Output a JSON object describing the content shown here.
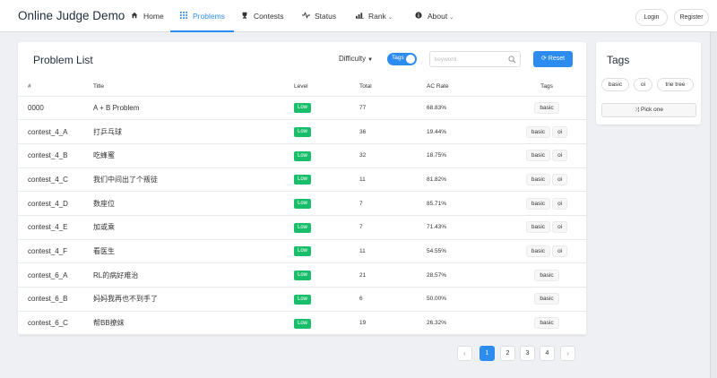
{
  "navbar": {
    "brand": "Online Judge Demo",
    "items": [
      {
        "label": "Home",
        "icon": "home-icon"
      },
      {
        "label": "Problems",
        "icon": "grid-icon",
        "active": true
      },
      {
        "label": "Contests",
        "icon": "trophy-icon"
      },
      {
        "label": "Status",
        "icon": "pulse-icon"
      },
      {
        "label": "Rank",
        "icon": "bar-chart-icon"
      },
      {
        "label": "About",
        "icon": "info-icon"
      }
    ],
    "login_label": "Login",
    "register_label": "Register"
  },
  "problem_panel": {
    "title": "Problem List",
    "difficulty_label": "Difficulty",
    "tags_toggle_label": "Tags",
    "tags_toggle_on": true,
    "search_placeholder": "keyword",
    "reset_label": "Reset",
    "columns": [
      "#",
      "Title",
      "Level",
      "Total",
      "AC Rate",
      "Tags"
    ],
    "rows": [
      {
        "id": "0000",
        "title": "A + B Problem",
        "level": "Low",
        "total": "77",
        "ac_rate": "68.83%",
        "tags": [
          "basic"
        ]
      },
      {
        "id": "contest_4_A",
        "title": "打乒乓球",
        "level": "Low",
        "total": "36",
        "ac_rate": "19.44%",
        "tags": [
          "basic",
          "oi"
        ]
      },
      {
        "id": "contest_4_B",
        "title": "吃蜂蜜",
        "level": "Low",
        "total": "32",
        "ac_rate": "18.75%",
        "tags": [
          "basic",
          "oi"
        ]
      },
      {
        "id": "contest_4_C",
        "title": "我们中间出了个叛徒",
        "level": "Low",
        "total": "11",
        "ac_rate": "81.82%",
        "tags": [
          "basic",
          "oi"
        ]
      },
      {
        "id": "contest_4_D",
        "title": "数座位",
        "level": "Low",
        "total": "7",
        "ac_rate": "85.71%",
        "tags": [
          "basic",
          "oi"
        ]
      },
      {
        "id": "contest_4_E",
        "title": "加或乘",
        "level": "Low",
        "total": "7",
        "ac_rate": "71.43%",
        "tags": [
          "basic",
          "oi"
        ]
      },
      {
        "id": "contest_4_F",
        "title": "看医生",
        "level": "Low",
        "total": "11",
        "ac_rate": "54.55%",
        "tags": [
          "basic",
          "oi"
        ]
      },
      {
        "id": "contest_6_A",
        "title": "RL的病好难治",
        "level": "Low",
        "total": "21",
        "ac_rate": "28.57%",
        "tags": [
          "basic"
        ]
      },
      {
        "id": "contest_6_B",
        "title": "妈妈我再也不到手了",
        "level": "Low",
        "total": "6",
        "ac_rate": "50.00%",
        "tags": [
          "basic"
        ]
      },
      {
        "id": "contest_6_C",
        "title": "帮BB撩妹",
        "level": "Low",
        "total": "19",
        "ac_rate": "26.32%",
        "tags": [
          "basic"
        ]
      }
    ]
  },
  "pagination": {
    "pages": [
      "1",
      "2",
      "3",
      "4"
    ],
    "current": "1",
    "prev_symbol": "‹",
    "next_symbol": "›"
  },
  "tags_panel": {
    "title": "Tags",
    "tags": [
      "basic",
      "oi",
      "trie tree"
    ],
    "pick_label": "Pick one"
  },
  "colors": {
    "accent": "#2d8cf0",
    "level_low": "#19be6b"
  }
}
